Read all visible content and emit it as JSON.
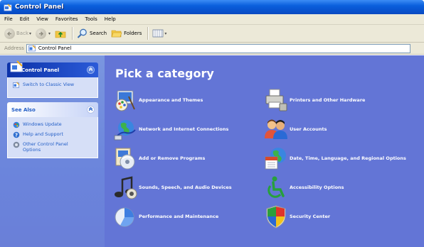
{
  "window": {
    "title": "Control Panel"
  },
  "menu": [
    "File",
    "Edit",
    "View",
    "Favorites",
    "Tools",
    "Help"
  ],
  "toolbar": {
    "back_label": "Back",
    "search_label": "Search",
    "folders_label": "Folders"
  },
  "address": {
    "label": "Address",
    "value": "Control Panel"
  },
  "sidebar": {
    "panel1": {
      "title": "Control Panel",
      "link": "Switch to Classic View"
    },
    "panel2": {
      "title": "See Also",
      "items": [
        {
          "label": "Windows Update",
          "icon": "windows-update-icon"
        },
        {
          "label": "Help and Support",
          "icon": "help-icon"
        },
        {
          "label": "Other Control Panel Options",
          "icon": "options-icon"
        }
      ]
    }
  },
  "main": {
    "heading": "Pick a category",
    "categories": [
      {
        "label": "Appearance and Themes",
        "icon": "appearance-icon"
      },
      {
        "label": "Printers and Other Hardware",
        "icon": "printer-icon"
      },
      {
        "label": "Network and Internet Connections",
        "icon": "network-icon"
      },
      {
        "label": "User Accounts",
        "icon": "users-icon"
      },
      {
        "label": "Add or Remove Programs",
        "icon": "add-remove-icon"
      },
      {
        "label": "Date, Time, Language, and Regional Options",
        "icon": "date-time-icon"
      },
      {
        "label": "Sounds, Speech, and Audio Devices",
        "icon": "sound-icon"
      },
      {
        "label": "Accessibility Options",
        "icon": "accessibility-icon"
      },
      {
        "label": "Performance and Maintenance",
        "icon": "performance-icon"
      },
      {
        "label": "Security Center",
        "icon": "security-icon"
      }
    ]
  },
  "colors": {
    "content_bg": "#6375d6",
    "titlebar": "#0a5fdc",
    "link": "#215dc6"
  }
}
